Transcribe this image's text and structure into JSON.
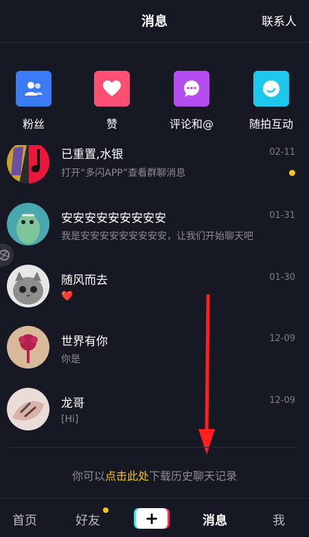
{
  "header": {
    "title": "消息",
    "contacts": "联系人"
  },
  "shortcuts": [
    {
      "label": "粉丝",
      "icon": "fans-icon",
      "color": "#3b7cf5"
    },
    {
      "label": "赞",
      "icon": "heart-icon",
      "color": "#fb4f73"
    },
    {
      "label": "评论和@",
      "icon": "comment-icon",
      "color": "#b54cf0"
    },
    {
      "label": "随拍互动",
      "icon": "camera-icon",
      "color": "#1ec8ea"
    }
  ],
  "conversations": [
    {
      "name": "已重置,水银",
      "preview": "打开“多闪APP”查看群聊消息",
      "time": "02-11",
      "unread": true
    },
    {
      "name": "安安安安安安安安安",
      "preview": "我是安安安安安安安安安，让我们开始聊天吧",
      "time": "01-31",
      "unread": false
    },
    {
      "name": "随风而去",
      "preview": "❤️",
      "time": "01-30",
      "unread": false
    },
    {
      "name": "世界有你",
      "preview": "你是",
      "time": "12-09",
      "unread": false
    },
    {
      "name": "龙哥",
      "preview": "[Hi]",
      "time": "12-09",
      "unread": false
    }
  ],
  "history": {
    "prefix": "你可以",
    "link": "点击此处",
    "suffix": "下载历史聊天记录"
  },
  "tabbar": {
    "home": "首页",
    "friends": "好友",
    "messages": "消息",
    "me": "我",
    "plus": "+"
  },
  "colors": {
    "background": "#161823",
    "accent": "#f5c518",
    "arrow": "#ff1f1f"
  }
}
